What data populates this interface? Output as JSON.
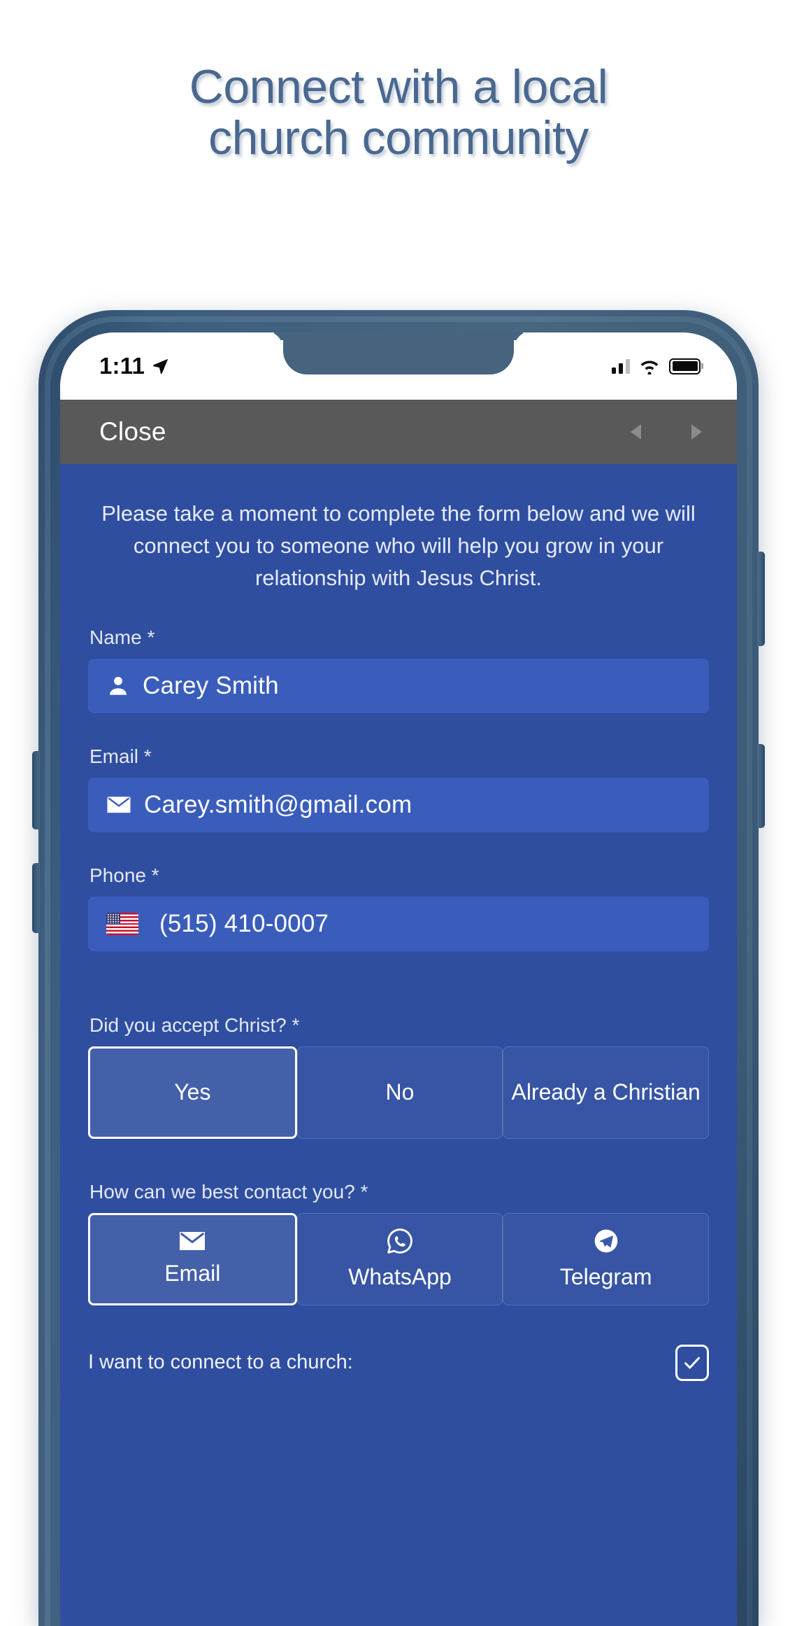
{
  "headline": {
    "line1": "Connect with a local",
    "line2": "church community",
    "color": "#4a688f"
  },
  "phone": {
    "statusbar": {
      "time": "1:11",
      "location_icon": "location-arrow-icon",
      "signal_icon": "cellular-signal-icon",
      "wifi_icon": "wifi-icon",
      "battery_icon": "battery-icon"
    },
    "navbar": {
      "close_label": "Close",
      "back_icon": "back-triangle-icon",
      "forward_icon": "forward-triangle-icon"
    }
  },
  "form": {
    "intro": "Please take a moment to complete the form below and we will connect you to someone who will help you grow in your relationship with Jesus Christ.",
    "fields": [
      {
        "label": "Name *",
        "icon": "person-icon",
        "value": "Carey Smith"
      },
      {
        "label": "Email *",
        "icon": "envelope-icon",
        "value": "Carey.smith@gmail.com"
      },
      {
        "label": "Phone *",
        "icon": "us-flag-icon",
        "value": "(515) 410-0007"
      }
    ],
    "accept_christ": {
      "label": "Did you accept Christ? *",
      "options": [
        {
          "label": "Yes",
          "selected": true
        },
        {
          "label": "No",
          "selected": false
        },
        {
          "label": "Already a Christian",
          "selected": false
        }
      ]
    },
    "contact_method": {
      "label": "How can we best contact you? *",
      "options": [
        {
          "label": "Email",
          "icon": "envelope-icon",
          "selected": true
        },
        {
          "label": "WhatsApp",
          "icon": "whatsapp-icon",
          "selected": false
        },
        {
          "label": "Telegram",
          "icon": "telegram-icon",
          "selected": false
        }
      ]
    },
    "connect_church": {
      "label": "I want to connect to a church:",
      "checked": true
    }
  },
  "colors": {
    "page_background": "#2f4ea0",
    "input_background": "#3a5dbc",
    "navbar_background": "#59595a",
    "device_frame": "#46647f",
    "headline": "#4a688f"
  }
}
